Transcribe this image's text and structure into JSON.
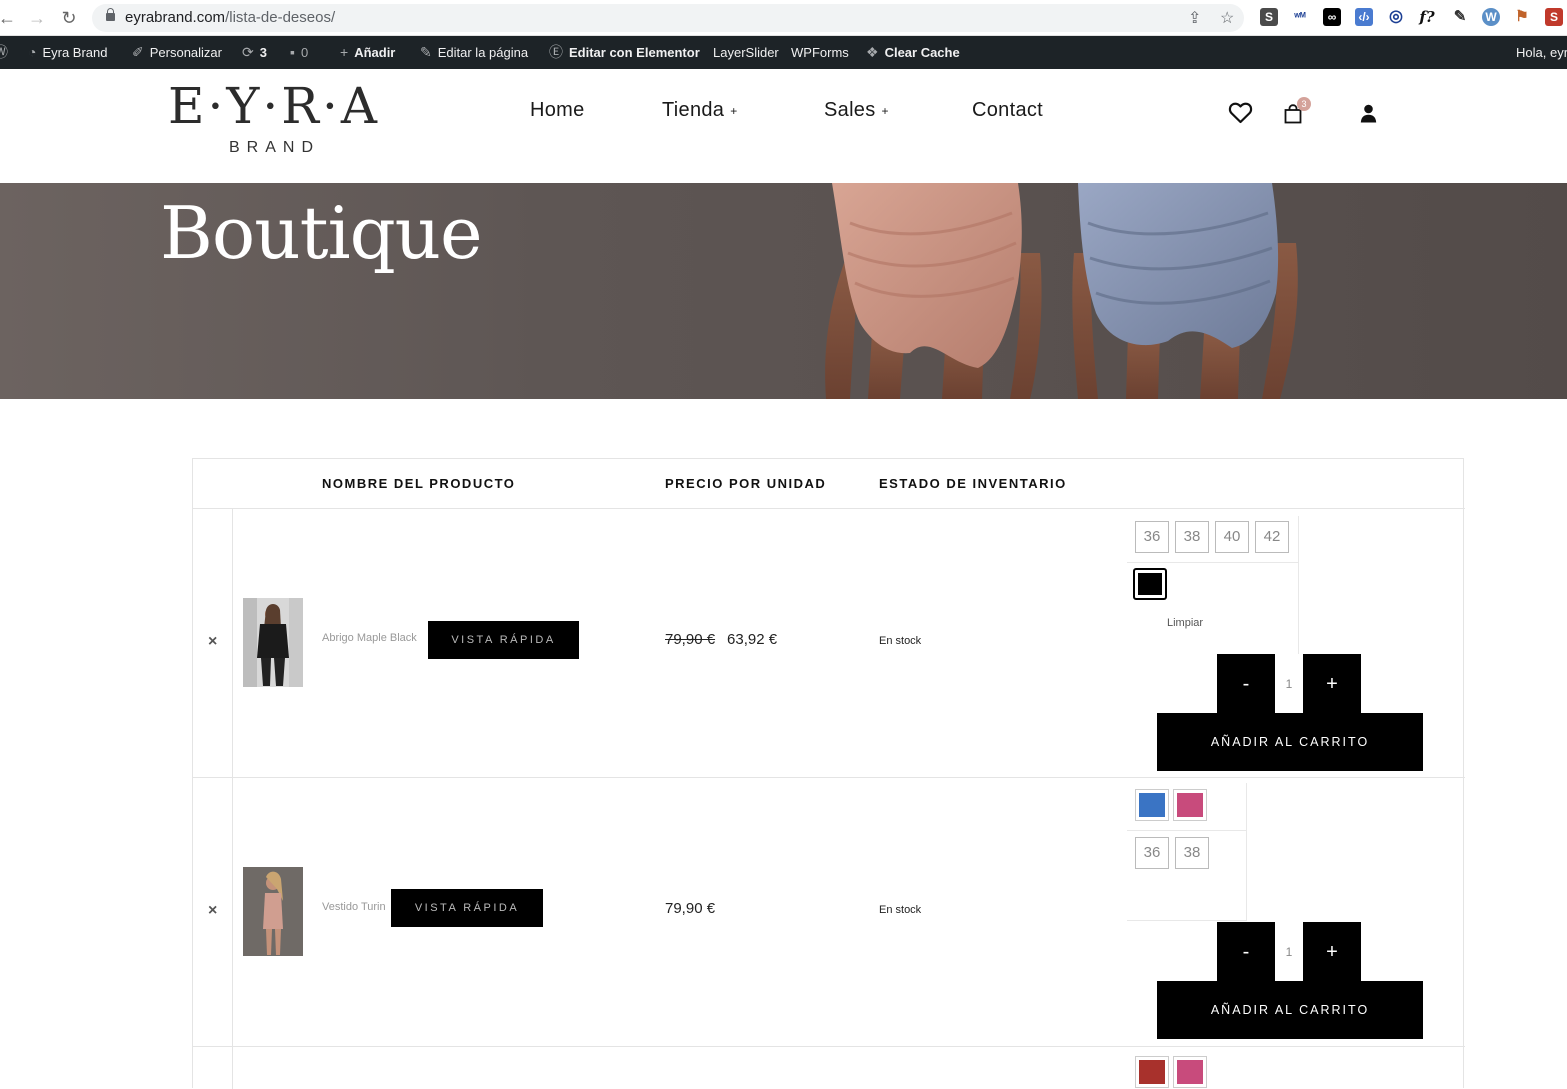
{
  "browser": {
    "url_domain": "eyrabrand.com",
    "url_path": "/lista-de-deseos/"
  },
  "adminbar": {
    "site_name": "Eyra Brand",
    "customize": "Personalizar",
    "updates_count": "3",
    "comments_count": "0",
    "add_new": "Añadir",
    "edit_page": "Editar la página",
    "edit_elementor": "Editar con Elementor",
    "layerslider": "LayerSlider",
    "wpforms": "WPForms",
    "clear_cache": "Clear Cache",
    "greeting": "Hola, eyr"
  },
  "header": {
    "logo_main": "E·Y·R·A",
    "logo_sub": "BRAND",
    "nav": [
      {
        "label": "Home",
        "has_sub": false
      },
      {
        "label": "Tienda",
        "has_sub": true
      },
      {
        "label": "Sales",
        "has_sub": true
      },
      {
        "label": "Contact",
        "has_sub": false
      }
    ],
    "cart_count": "3",
    "plus_glyph": "+"
  },
  "hero": {
    "title": "Boutique"
  },
  "wishlist": {
    "columns": {
      "name": "NOMBRE DEL PRODUCTO",
      "price": "PRECIO POR UNIDAD",
      "stock": "ESTADO DE INVENTARIO"
    },
    "remove_glyph": "×",
    "quick_view": "VISTA RÁPIDA",
    "add_to_cart": "AÑADIR AL CARRITO",
    "qty_minus": "-",
    "qty_plus": "+",
    "clear": "Limpiar",
    "items": [
      {
        "name": "Abrigo Maple Black",
        "old_price": "79,90 €",
        "price": "63,92 €",
        "stock": "En stock",
        "sizes": [
          "36",
          "38",
          "40",
          "42"
        ],
        "colors": [
          "#000000"
        ],
        "quantity": "1"
      },
      {
        "name": "Vestido Turin",
        "price": "79,90 €",
        "stock": "En stock",
        "colors": [
          "#3a74c4",
          "#c84b7c"
        ],
        "sizes": [
          "36",
          "38"
        ],
        "quantity": "1"
      },
      {
        "colors": [
          "#a8312c",
          "#c84b7c"
        ]
      }
    ]
  }
}
